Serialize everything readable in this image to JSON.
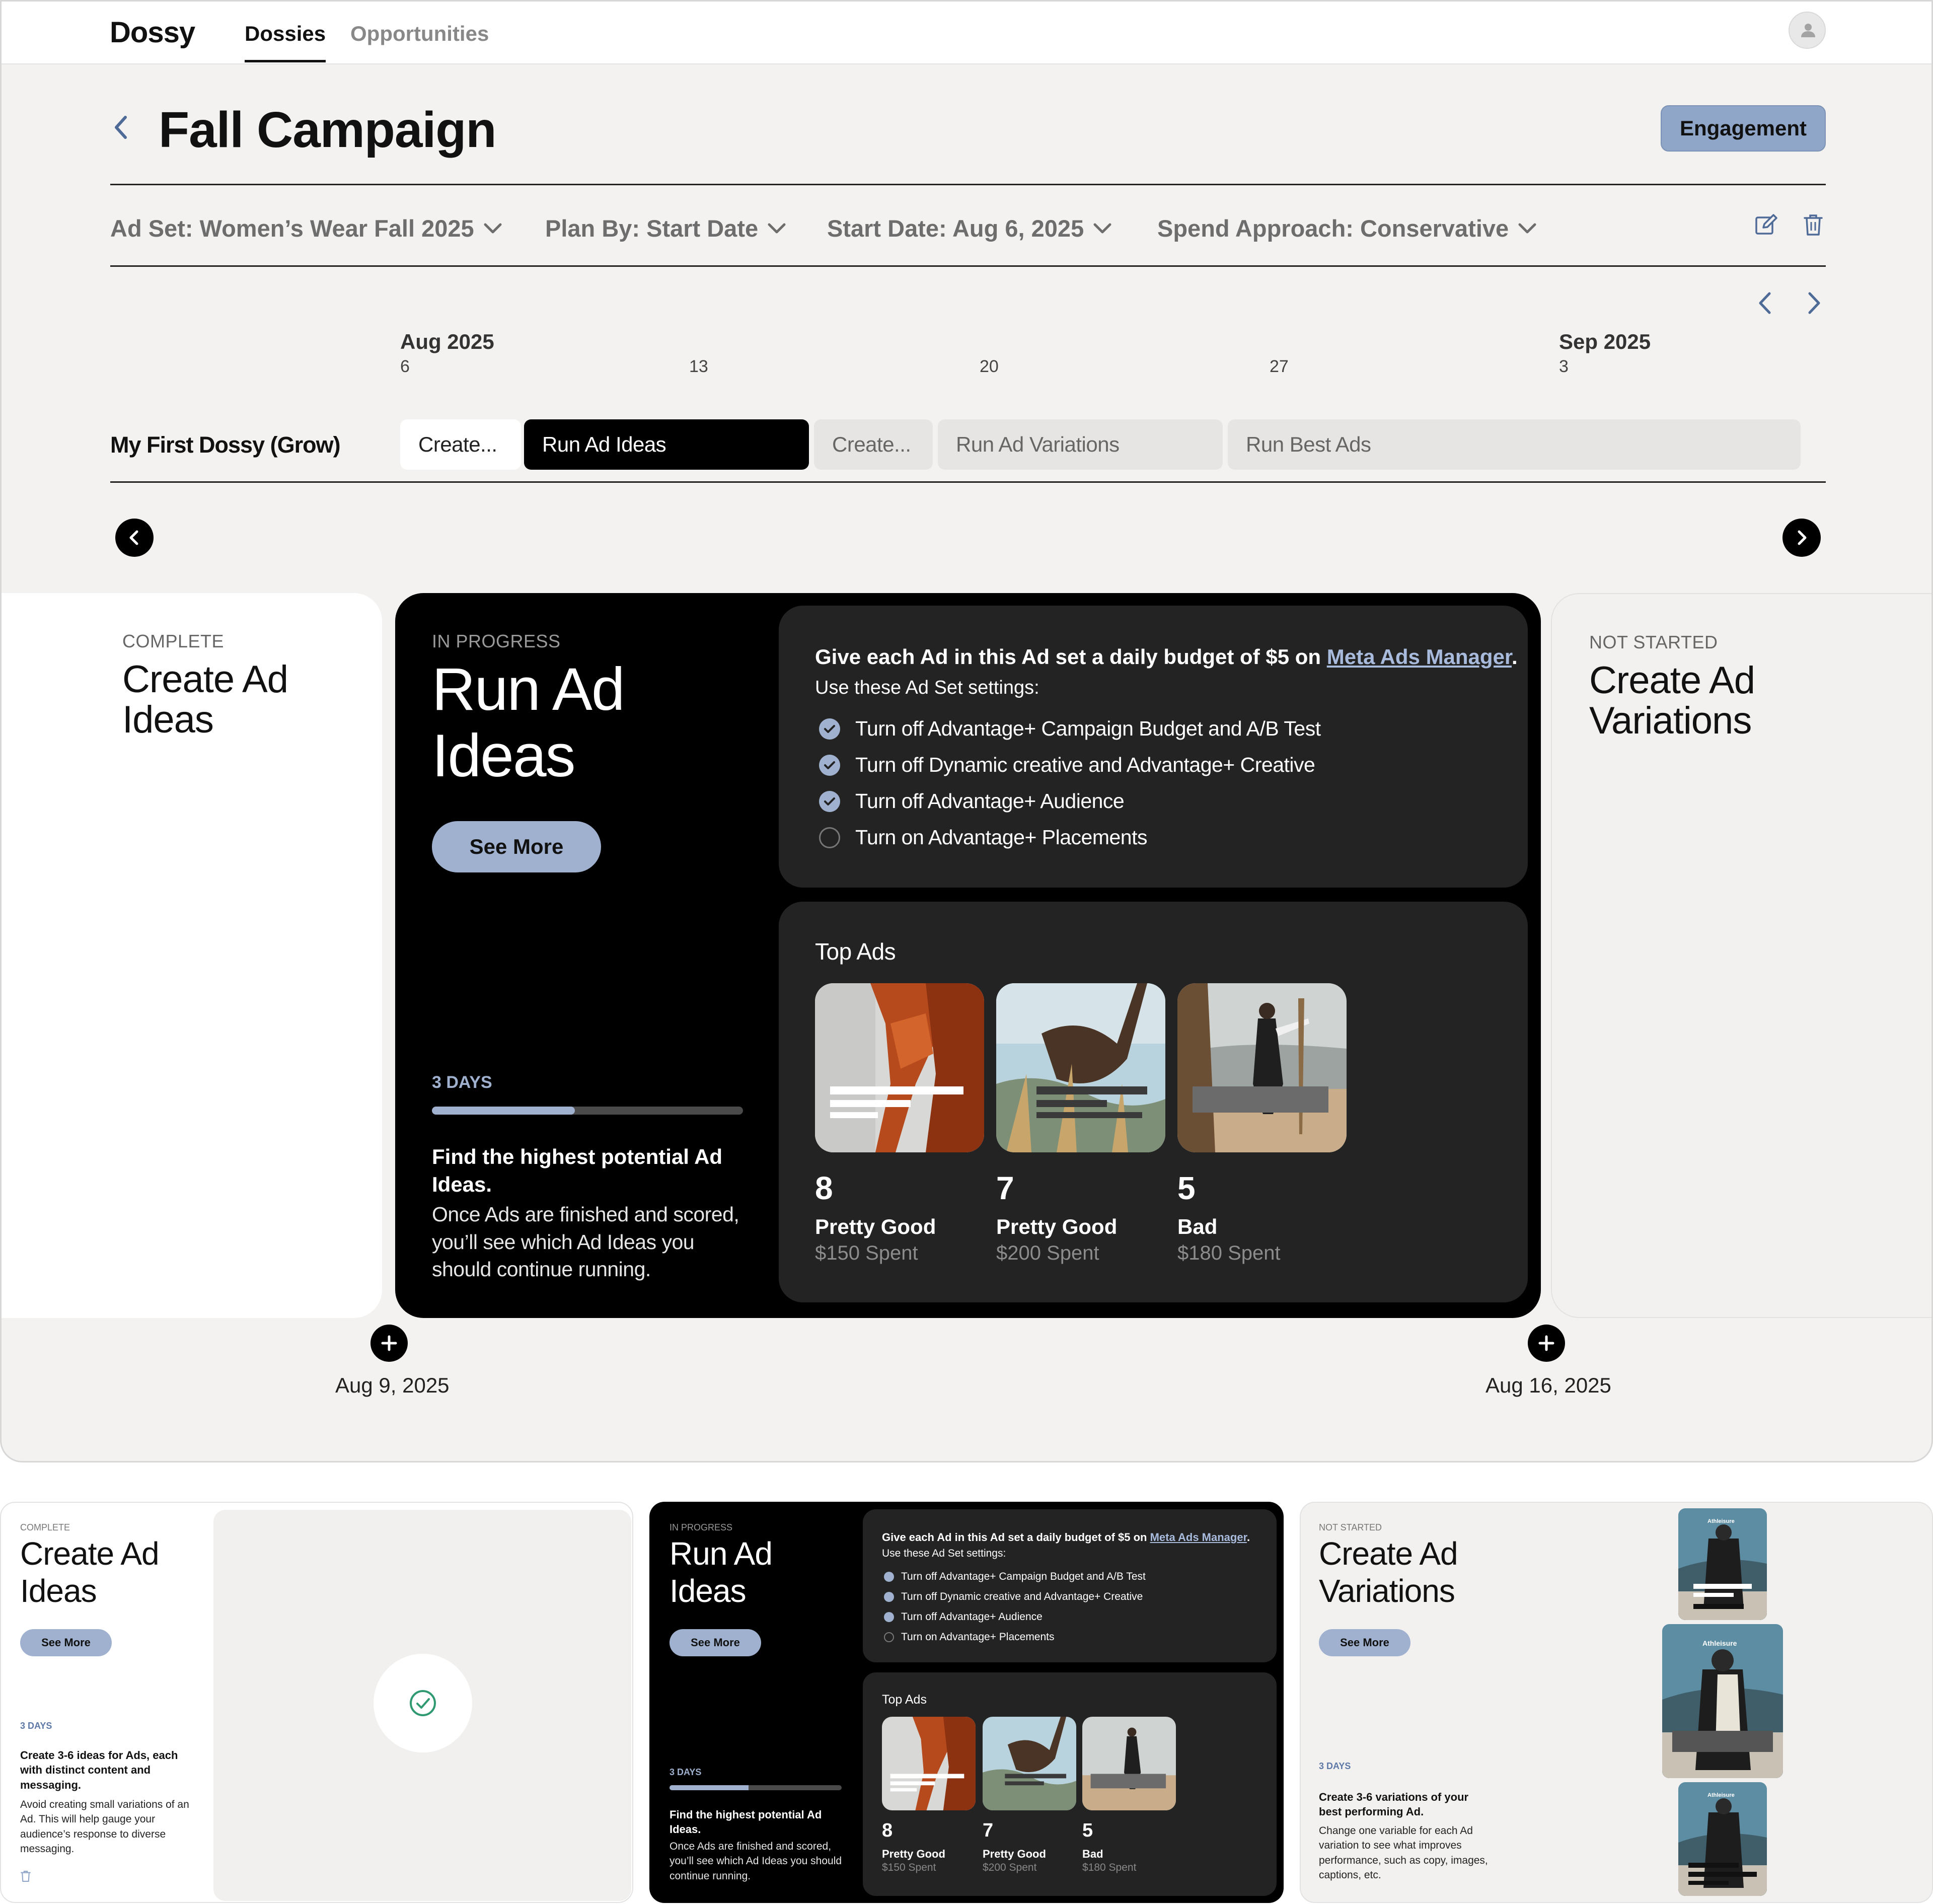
{
  "app": {
    "logo": "Dossy",
    "nav_tabs": [
      {
        "label": "Dossies",
        "active": true
      },
      {
        "label": "Opportunities",
        "active": false
      }
    ]
  },
  "header": {
    "title": "Fall Campaign",
    "badge": "Engagement"
  },
  "filters": {
    "ad_set": "Ad Set: Women’s Wear Fall 2025",
    "plan_by": "Plan By: Start Date",
    "start_date": "Start Date: Aug 6, 2025",
    "spend_approach": "Spend Approach: Conservative",
    "edit_icon": "edit-icon",
    "delete_icon": "trash-icon"
  },
  "timeline": {
    "months": [
      "Aug 2025",
      "Sep 2025"
    ],
    "days": [
      "6",
      "13",
      "20",
      "27",
      "3"
    ],
    "row_label": "My First Dossy (Grow)",
    "phases": [
      {
        "label": "Create...",
        "state": "complete"
      },
      {
        "label": "Run Ad Ideas",
        "state": "active"
      },
      {
        "label": "Create...",
        "state": "pending"
      },
      {
        "label": "Run Ad Variations",
        "state": "pending"
      },
      {
        "label": "Run Best Ads",
        "state": "pending"
      }
    ]
  },
  "cards": {
    "prev": {
      "status": "COMPLETE",
      "title_line1": "Create Ad",
      "title_line2": "Ideas"
    },
    "current": {
      "status": "IN PROGRESS",
      "title_line1": "Run Ad",
      "title_line2": "Ideas",
      "see_more": "See More",
      "days": "3 DAYS",
      "progress": 0.46,
      "desc_bold": "Find the highest potential Ad Ideas.",
      "desc": "Once Ads are finished and scored, you’ll see which Ad Ideas you should continue running.",
      "instructions": {
        "head_prefix": "Give each Ad in this Ad set a daily budget of $5 on ",
        "head_link": "Meta Ads Manager",
        "head_suffix": ".",
        "sub": "Use these Ad Set settings:",
        "items": [
          {
            "label": "Turn off Advantage+ Campaign Budget and A/B Test",
            "checked": true
          },
          {
            "label": "Turn off Dynamic creative and Advantage+ Creative",
            "checked": true
          },
          {
            "label": "Turn off Advantage+ Audience",
            "checked": true
          },
          {
            "label": "Turn on Advantage+ Placements",
            "checked": false
          }
        ]
      },
      "top_ads": {
        "title": "Top Ads",
        "ads": [
          {
            "score": "8",
            "rating": "Pretty Good",
            "spent": "$150 Spent"
          },
          {
            "score": "7",
            "rating": "Pretty Good",
            "spent": "$200 Spent"
          },
          {
            "score": "5",
            "rating": "Bad",
            "spent": "$180 Spent"
          }
        ]
      }
    },
    "next": {
      "status": "NOT STARTED",
      "title_line1": "Create Ad",
      "title_line2": "Variations"
    },
    "dates": {
      "left": "Aug 9, 2025",
      "right": "Aug 16, 2025"
    }
  },
  "thumbnails": {
    "first": {
      "status": "COMPLETE",
      "title_line1": "Create Ad",
      "title_line2": "Ideas",
      "see_more": "See More",
      "days": "3 DAYS",
      "desc_bold": "Create 3-6 ideas for Ads, each with distinct content and messaging.",
      "desc": "Avoid creating small variations of an Ad. This will help gauge your audience’s response to diverse messaging."
    },
    "second": {
      "status": "IN PROGRESS",
      "title_line1": "Run Ad",
      "title_line2": "Ideas",
      "see_more": "See More",
      "days": "3 DAYS",
      "desc_bold": "Find the highest potential Ad Ideas.",
      "desc": "Once Ads are finished and scored, you’ll see which Ad Ideas you should continue running."
    },
    "third": {
      "status": "NOT STARTED",
      "title_line1": "Create Ad",
      "title_line2": "Variations",
      "see_more": "See More",
      "days": "3 DAYS",
      "desc_bold": "Create 3-6 variations of your best performing Ad.",
      "desc": "Change one variable for each Ad variation to see what improves performance, such as copy, images, captions, etc.",
      "poster_brand": "Athleisure"
    }
  },
  "colors": {
    "accent": "#9fb1cf",
    "dark_panel": "#232323",
    "background": "#f3f2f0"
  }
}
